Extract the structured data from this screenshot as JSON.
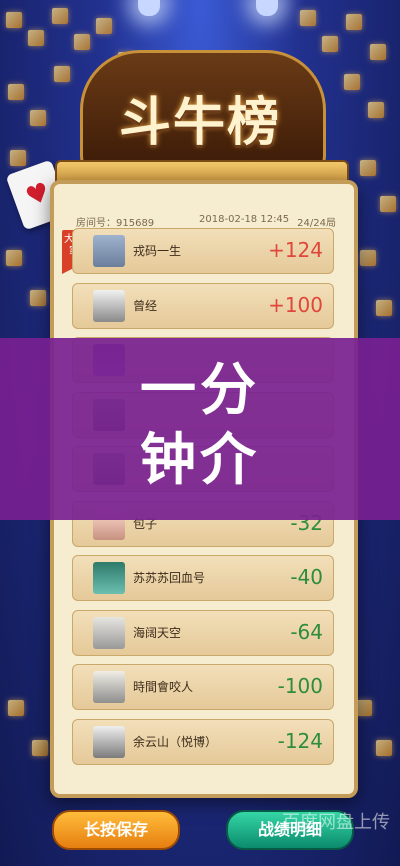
{
  "title": "斗牛榜",
  "meta": {
    "room_label": "房间号：915689",
    "datetime": "2018-02-18 12:45",
    "round": "24/24局"
  },
  "winner_badge": "大赢家",
  "players": [
    {
      "name": "戎码一生",
      "score": "+124",
      "sign": "pos",
      "avatar": "av1"
    },
    {
      "name": "曾经",
      "score": "+100",
      "sign": "pos",
      "avatar": "av2"
    },
    {
      "name": "",
      "score": "",
      "sign": "pos",
      "avatar": "av3"
    },
    {
      "name": "",
      "score": "",
      "sign": "pos",
      "avatar": "av4"
    },
    {
      "name": "",
      "score": "",
      "sign": "pos",
      "avatar": "av4"
    },
    {
      "name": "包子",
      "score": "-32",
      "sign": "neg",
      "avatar": "av5"
    },
    {
      "name": "苏苏苏回血号",
      "score": "-40",
      "sign": "neg",
      "avatar": "av6"
    },
    {
      "name": "海阔天空",
      "score": "-64",
      "sign": "neg",
      "avatar": "av7"
    },
    {
      "name": "時間會咬人",
      "score": "-100",
      "sign": "neg",
      "avatar": "av8"
    },
    {
      "name": "余云山（悦博）",
      "score": "-124",
      "sign": "neg",
      "avatar": "av9"
    }
  ],
  "overlay_text": "一分\n钟介",
  "buttons": {
    "save": "长按保存",
    "detail": "战绩明细"
  },
  "watermark": "百度网盘上传"
}
